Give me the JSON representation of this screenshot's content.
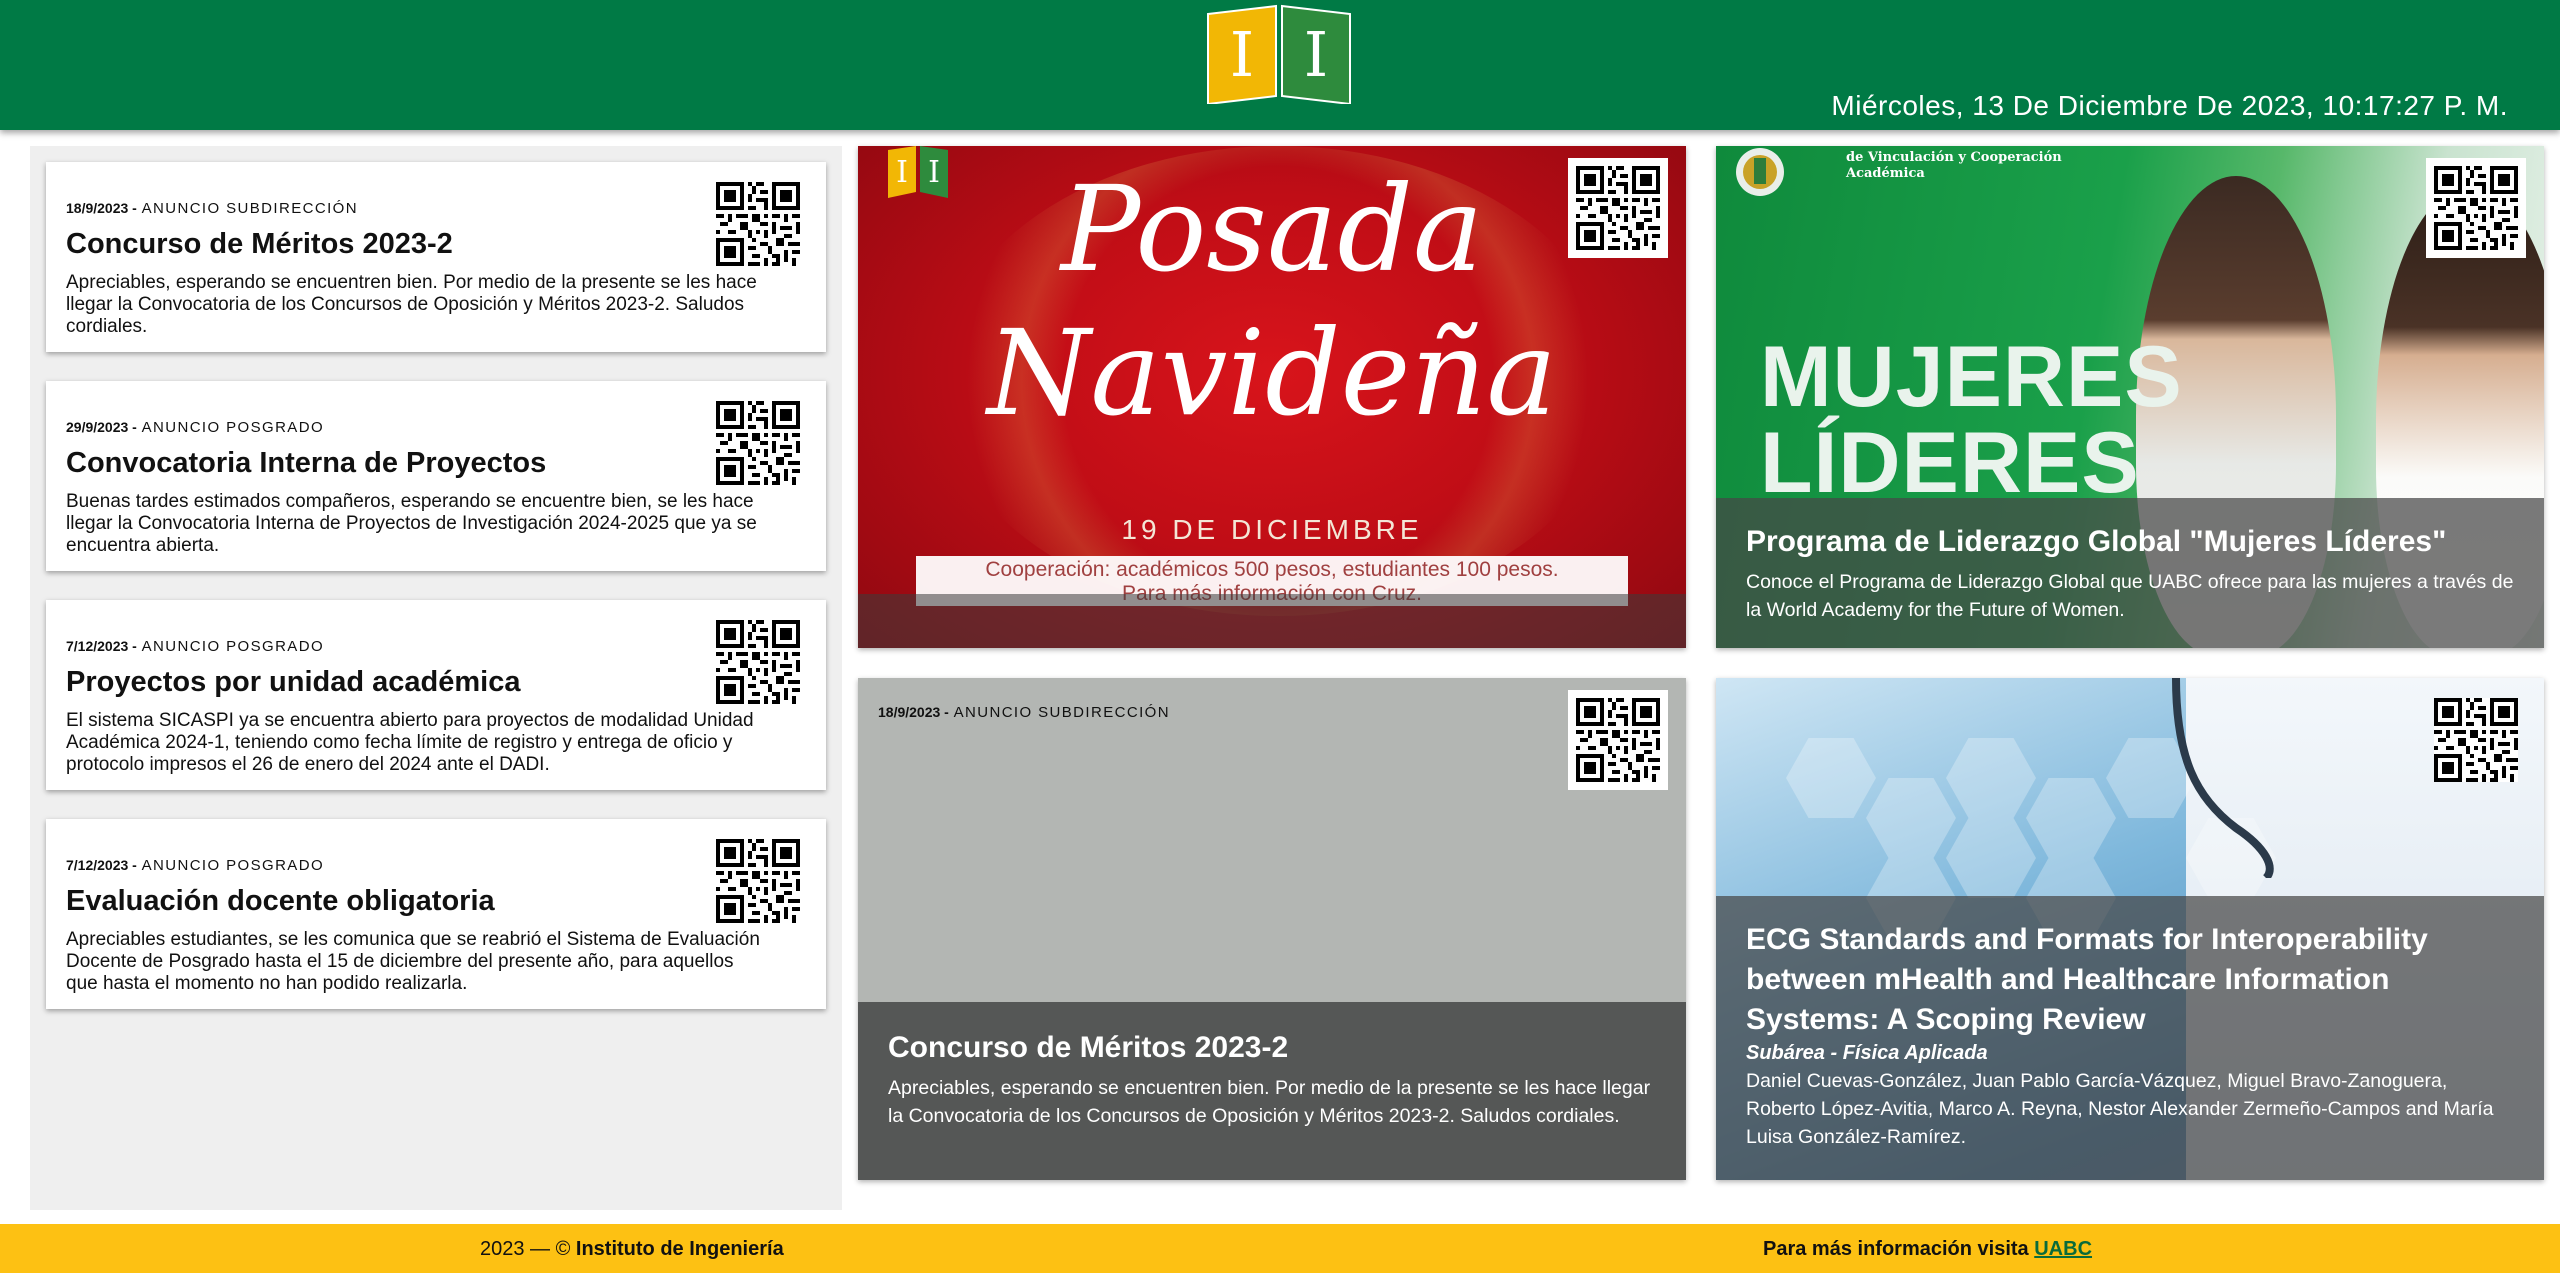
{
  "header": {
    "datetime": "Miércoles, 13 De Diciembre De 2023, 10:17:27 P. M.",
    "logo_icon": "institute-logo-icon",
    "colors": {
      "brand_green": "#007a45",
      "brand_yellow": "#fdc113"
    }
  },
  "announcements": [
    {
      "date": "18/9/2023 -",
      "category": "ANUNCIO SUBDIRECCIÓN",
      "title": "Concurso de Méritos 2023-2",
      "body": "Apreciables, esperando se encuentren bien. Por medio de la presente se les hace llegar la Convocatoria de los Concursos de Oposición y Méritos 2023-2. Saludos cordiales."
    },
    {
      "date": "29/9/2023 -",
      "category": "ANUNCIO POSGRADO",
      "title": "Convocatoria Interna de Proyectos",
      "body": "Buenas tardes estimados compañeros, esperando se encuentre bien, se les hace llegar la Convocatoria Interna de Proyectos de Investigación 2024-2025 que ya se encuentra abierta."
    },
    {
      "date": "7/12/2023 -",
      "category": "ANUNCIO POSGRADO",
      "title": "Proyectos por unidad académica",
      "body": "El sistema SICASPI ya se encuentra abierto para proyectos de modalidad Unidad Académica 2024-1, teniendo como fecha límite de registro y entrega de oficio y protocolo impresos el 26 de enero del 2024 ante el DADI."
    },
    {
      "date": "7/12/2023 -",
      "category": "ANUNCIO POSGRADO",
      "title": "Evaluación docente obligatoria",
      "body": "Apreciables estudiantes, se les comunica que se reabrió el Sistema de Evaluación Docente de Posgrado hasta el 15 de diciembre del presente año, para aquellos que hasta el momento no han podido realizarla."
    }
  ],
  "tiles": {
    "posada": {
      "title_line1": "Posada",
      "title_line2": "Navideña",
      "date": "19 DE DICIEMBRE",
      "info_line1": "Cooperación: académicos 500 pesos, estudiantes 100 pesos.",
      "info_line2": "Para más información con Cruz."
    },
    "mujeres": {
      "header_line1": "de Vinculación y Cooperación",
      "header_line2": "Académica",
      "big_line1": "MUJERES",
      "big_line2": "LÍDERES",
      "title": "Programa de Liderazgo Global \"Mujeres Líderes\"",
      "body": "Conoce el Programa de Liderazgo Global que UABC ofrece para las mujeres a través de la World Academy for the Future of Women."
    },
    "concurso": {
      "date": "18/9/2023 -",
      "category": "ANUNCIO SUBDIRECCIÓN",
      "title": "Concurso de Méritos 2023-2",
      "body": "Apreciables, esperando se encuentren bien. Por medio de la presente se les hace llegar la Convocatoria de los Concursos de Oposición y Méritos 2023-2. Saludos cordiales."
    },
    "ecg": {
      "title": "ECG Standards and Formats for Interoperability between mHealth and Healthcare Information Systems: A Scoping Review",
      "subarea": "Subárea - Física Aplicada",
      "authors": "Daniel Cuevas-González, Juan Pablo García-Vázquez, Miguel Bravo-Zanoguera, Roberto López-Avitia, Marco A. Reyna, Nestor Alexander Zermeño-Campos and María Luisa González-Ramírez."
    }
  },
  "footer": {
    "copyright_prefix": "2023 — ©",
    "institute": "Instituto de Ingeniería",
    "more_info": "Para más información visita",
    "link_label": "UABC"
  }
}
